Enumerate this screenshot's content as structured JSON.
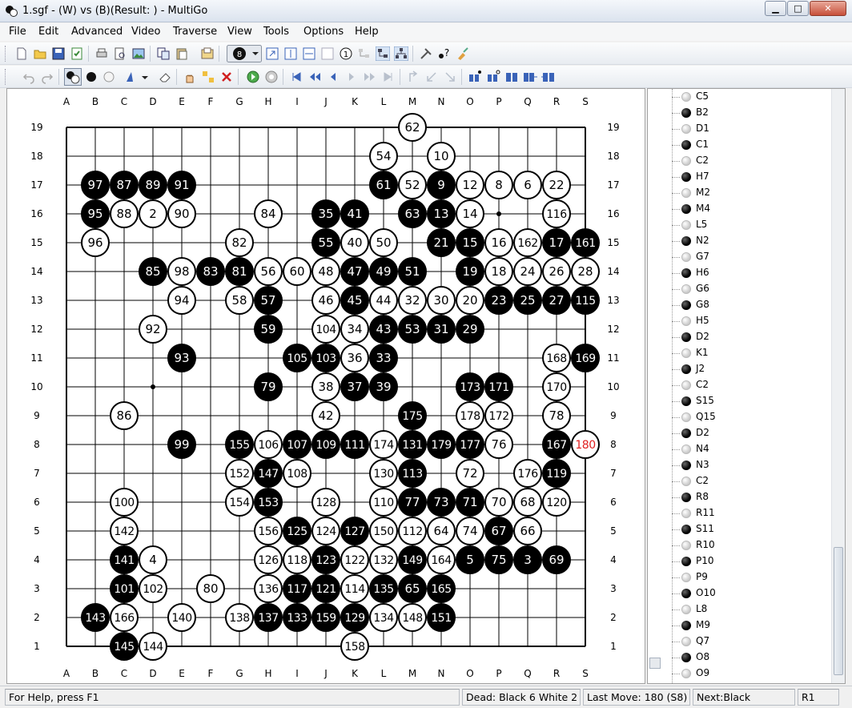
{
  "window": {
    "title": "1.sgf -  (W) vs  (B)(Result: ) - MultiGo"
  },
  "menu": [
    "File",
    "Edit",
    "Advanced",
    "Video",
    "Traverse",
    "View",
    "Tools",
    "Options",
    "Help"
  ],
  "board": {
    "columns": [
      "A",
      "B",
      "C",
      "D",
      "E",
      "F",
      "G",
      "H",
      "I",
      "J",
      "K",
      "L",
      "M",
      "N",
      "O",
      "P",
      "Q",
      "R",
      "S"
    ],
    "rows": [
      "19",
      "18",
      "17",
      "16",
      "15",
      "14",
      "13",
      "12",
      "11",
      "10",
      "9",
      "8",
      "7",
      "6",
      "5",
      "4",
      "3",
      "2",
      "1"
    ],
    "stones": [
      {
        "c": "M",
        "r": 19,
        "color": "white",
        "num": "62"
      },
      {
        "c": "L",
        "r": 18,
        "color": "white",
        "num": "54"
      },
      {
        "c": "N",
        "r": 18,
        "color": "white",
        "num": "10"
      },
      {
        "c": "B",
        "r": 17,
        "color": "black",
        "num": "97"
      },
      {
        "c": "C",
        "r": 17,
        "color": "black",
        "num": "87"
      },
      {
        "c": "D",
        "r": 17,
        "color": "black",
        "num": "89"
      },
      {
        "c": "E",
        "r": 17,
        "color": "black",
        "num": "91"
      },
      {
        "c": "L",
        "r": 17,
        "color": "black",
        "num": "61"
      },
      {
        "c": "M",
        "r": 17,
        "color": "white",
        "num": "52"
      },
      {
        "c": "N",
        "r": 17,
        "color": "black",
        "num": "9"
      },
      {
        "c": "O",
        "r": 17,
        "color": "white",
        "num": "12"
      },
      {
        "c": "P",
        "r": 17,
        "color": "white",
        "num": "8"
      },
      {
        "c": "Q",
        "r": 17,
        "color": "white",
        "num": "6"
      },
      {
        "c": "R",
        "r": 17,
        "color": "white",
        "num": "22"
      },
      {
        "c": "B",
        "r": 16,
        "color": "black",
        "num": "95"
      },
      {
        "c": "C",
        "r": 16,
        "color": "white",
        "num": "88"
      },
      {
        "c": "D",
        "r": 16,
        "color": "white",
        "num": "2"
      },
      {
        "c": "E",
        "r": 16,
        "color": "white",
        "num": "90"
      },
      {
        "c": "H",
        "r": 16,
        "color": "white",
        "num": "84"
      },
      {
        "c": "J",
        "r": 16,
        "color": "black",
        "num": "35"
      },
      {
        "c": "K",
        "r": 16,
        "color": "black",
        "num": "41"
      },
      {
        "c": "M",
        "r": 16,
        "color": "black",
        "num": "63"
      },
      {
        "c": "N",
        "r": 16,
        "color": "black",
        "num": "13"
      },
      {
        "c": "O",
        "r": 16,
        "color": "white",
        "num": "14"
      },
      {
        "c": "R",
        "r": 16,
        "color": "white",
        "num": "116"
      },
      {
        "c": "B",
        "r": 15,
        "color": "white",
        "num": "96"
      },
      {
        "c": "G",
        "r": 15,
        "color": "white",
        "num": "82"
      },
      {
        "c": "J",
        "r": 15,
        "color": "black",
        "num": "55"
      },
      {
        "c": "K",
        "r": 15,
        "color": "white",
        "num": "40"
      },
      {
        "c": "L",
        "r": 15,
        "color": "white",
        "num": "50"
      },
      {
        "c": "N",
        "r": 15,
        "color": "black",
        "num": "21"
      },
      {
        "c": "O",
        "r": 15,
        "color": "black",
        "num": "15"
      },
      {
        "c": "P",
        "r": 15,
        "color": "white",
        "num": "16"
      },
      {
        "c": "Q",
        "r": 15,
        "color": "white",
        "num": "162"
      },
      {
        "c": "R",
        "r": 15,
        "color": "black",
        "num": "17"
      },
      {
        "c": "S",
        "r": 15,
        "color": "black",
        "num": "161"
      },
      {
        "c": "D",
        "r": 14,
        "color": "black",
        "num": "85"
      },
      {
        "c": "E",
        "r": 14,
        "color": "white",
        "num": "98"
      },
      {
        "c": "F",
        "r": 14,
        "color": "black",
        "num": "83"
      },
      {
        "c": "G",
        "r": 14,
        "color": "black",
        "num": "81"
      },
      {
        "c": "H",
        "r": 14,
        "color": "white",
        "num": "56"
      },
      {
        "c": "I",
        "r": 14,
        "color": "white",
        "num": "60"
      },
      {
        "c": "J",
        "r": 14,
        "color": "white",
        "num": "48"
      },
      {
        "c": "K",
        "r": 14,
        "color": "black",
        "num": "47"
      },
      {
        "c": "L",
        "r": 14,
        "color": "black",
        "num": "49"
      },
      {
        "c": "M",
        "r": 14,
        "color": "black",
        "num": "51"
      },
      {
        "c": "O",
        "r": 14,
        "color": "black",
        "num": "19"
      },
      {
        "c": "P",
        "r": 14,
        "color": "white",
        "num": "18"
      },
      {
        "c": "Q",
        "r": 14,
        "color": "white",
        "num": "24"
      },
      {
        "c": "R",
        "r": 14,
        "color": "white",
        "num": "26"
      },
      {
        "c": "S",
        "r": 14,
        "color": "white",
        "num": "28"
      },
      {
        "c": "E",
        "r": 13,
        "color": "white",
        "num": "94"
      },
      {
        "c": "G",
        "r": 13,
        "color": "white",
        "num": "58"
      },
      {
        "c": "H",
        "r": 13,
        "color": "black",
        "num": "57"
      },
      {
        "c": "J",
        "r": 13,
        "color": "white",
        "num": "46"
      },
      {
        "c": "K",
        "r": 13,
        "color": "black",
        "num": "45"
      },
      {
        "c": "L",
        "r": 13,
        "color": "white",
        "num": "44"
      },
      {
        "c": "M",
        "r": 13,
        "color": "white",
        "num": "32"
      },
      {
        "c": "N",
        "r": 13,
        "color": "white",
        "num": "30"
      },
      {
        "c": "O",
        "r": 13,
        "color": "white",
        "num": "20"
      },
      {
        "c": "P",
        "r": 13,
        "color": "black",
        "num": "23"
      },
      {
        "c": "Q",
        "r": 13,
        "color": "black",
        "num": "25"
      },
      {
        "c": "R",
        "r": 13,
        "color": "black",
        "num": "27"
      },
      {
        "c": "S",
        "r": 13,
        "color": "black",
        "num": "115"
      },
      {
        "c": "D",
        "r": 12,
        "color": "white",
        "num": "92"
      },
      {
        "c": "H",
        "r": 12,
        "color": "black",
        "num": "59"
      },
      {
        "c": "J",
        "r": 12,
        "color": "white",
        "num": "104"
      },
      {
        "c": "K",
        "r": 12,
        "color": "white",
        "num": "34"
      },
      {
        "c": "L",
        "r": 12,
        "color": "black",
        "num": "43"
      },
      {
        "c": "M",
        "r": 12,
        "color": "black",
        "num": "53"
      },
      {
        "c": "N",
        "r": 12,
        "color": "black",
        "num": "31"
      },
      {
        "c": "O",
        "r": 12,
        "color": "black",
        "num": "29"
      },
      {
        "c": "E",
        "r": 11,
        "color": "black",
        "num": "93"
      },
      {
        "c": "I",
        "r": 11,
        "color": "black",
        "num": "105"
      },
      {
        "c": "J",
        "r": 11,
        "color": "black",
        "num": "103"
      },
      {
        "c": "K",
        "r": 11,
        "color": "white",
        "num": "36"
      },
      {
        "c": "L",
        "r": 11,
        "color": "black",
        "num": "33"
      },
      {
        "c": "R",
        "r": 11,
        "color": "white",
        "num": "168"
      },
      {
        "c": "S",
        "r": 11,
        "color": "black",
        "num": "169"
      },
      {
        "c": "H",
        "r": 10,
        "color": "black",
        "num": "79"
      },
      {
        "c": "J",
        "r": 10,
        "color": "white",
        "num": "38"
      },
      {
        "c": "K",
        "r": 10,
        "color": "black",
        "num": "37"
      },
      {
        "c": "L",
        "r": 10,
        "color": "black",
        "num": "39"
      },
      {
        "c": "O",
        "r": 10,
        "color": "black",
        "num": "173"
      },
      {
        "c": "P",
        "r": 10,
        "color": "black",
        "num": "171"
      },
      {
        "c": "R",
        "r": 10,
        "color": "white",
        "num": "170"
      },
      {
        "c": "C",
        "r": 9,
        "color": "white",
        "num": "86"
      },
      {
        "c": "J",
        "r": 9,
        "color": "white",
        "num": "42"
      },
      {
        "c": "M",
        "r": 9,
        "color": "black",
        "num": "175"
      },
      {
        "c": "O",
        "r": 9,
        "color": "white",
        "num": "178"
      },
      {
        "c": "P",
        "r": 9,
        "color": "white",
        "num": "172"
      },
      {
        "c": "R",
        "r": 9,
        "color": "white",
        "num": "78"
      },
      {
        "c": "E",
        "r": 8,
        "color": "black",
        "num": "99"
      },
      {
        "c": "G",
        "r": 8,
        "color": "black",
        "num": "155"
      },
      {
        "c": "H",
        "r": 8,
        "color": "white",
        "num": "106"
      },
      {
        "c": "I",
        "r": 8,
        "color": "black",
        "num": "107"
      },
      {
        "c": "J",
        "r": 8,
        "color": "black",
        "num": "109"
      },
      {
        "c": "K",
        "r": 8,
        "color": "black",
        "num": "111"
      },
      {
        "c": "L",
        "r": 8,
        "color": "white",
        "num": "174"
      },
      {
        "c": "M",
        "r": 8,
        "color": "black",
        "num": "131"
      },
      {
        "c": "N",
        "r": 8,
        "color": "black",
        "num": "179"
      },
      {
        "c": "O",
        "r": 8,
        "color": "black",
        "num": "177"
      },
      {
        "c": "P",
        "r": 8,
        "color": "white",
        "num": "76"
      },
      {
        "c": "R",
        "r": 8,
        "color": "black",
        "num": "167"
      },
      {
        "c": "S",
        "r": 8,
        "color": "white",
        "num": "180",
        "last": true
      },
      {
        "c": "G",
        "r": 7,
        "color": "white",
        "num": "152"
      },
      {
        "c": "H",
        "r": 7,
        "color": "black",
        "num": "147"
      },
      {
        "c": "I",
        "r": 7,
        "color": "white",
        "num": "108"
      },
      {
        "c": "L",
        "r": 7,
        "color": "white",
        "num": "130"
      },
      {
        "c": "M",
        "r": 7,
        "color": "black",
        "num": "113"
      },
      {
        "c": "O",
        "r": 7,
        "color": "white",
        "num": "72"
      },
      {
        "c": "Q",
        "r": 7,
        "color": "white",
        "num": "176"
      },
      {
        "c": "R",
        "r": 7,
        "color": "black",
        "num": "119"
      },
      {
        "c": "C",
        "r": 6,
        "color": "white",
        "num": "100"
      },
      {
        "c": "G",
        "r": 6,
        "color": "white",
        "num": "154"
      },
      {
        "c": "H",
        "r": 6,
        "color": "black",
        "num": "153"
      },
      {
        "c": "J",
        "r": 6,
        "color": "white",
        "num": "128"
      },
      {
        "c": "L",
        "r": 6,
        "color": "white",
        "num": "110"
      },
      {
        "c": "M",
        "r": 6,
        "color": "black",
        "num": "77"
      },
      {
        "c": "N",
        "r": 6,
        "color": "black",
        "num": "73"
      },
      {
        "c": "O",
        "r": 6,
        "color": "black",
        "num": "71"
      },
      {
        "c": "P",
        "r": 6,
        "color": "white",
        "num": "70"
      },
      {
        "c": "Q",
        "r": 6,
        "color": "white",
        "num": "68"
      },
      {
        "c": "R",
        "r": 6,
        "color": "white",
        "num": "120"
      },
      {
        "c": "C",
        "r": 5,
        "color": "white",
        "num": "142"
      },
      {
        "c": "H",
        "r": 5,
        "color": "white",
        "num": "156"
      },
      {
        "c": "I",
        "r": 5,
        "color": "black",
        "num": "125"
      },
      {
        "c": "J",
        "r": 5,
        "color": "white",
        "num": "124"
      },
      {
        "c": "K",
        "r": 5,
        "color": "black",
        "num": "127"
      },
      {
        "c": "L",
        "r": 5,
        "color": "white",
        "num": "150"
      },
      {
        "c": "M",
        "r": 5,
        "color": "white",
        "num": "112"
      },
      {
        "c": "N",
        "r": 5,
        "color": "white",
        "num": "64"
      },
      {
        "c": "O",
        "r": 5,
        "color": "white",
        "num": "74"
      },
      {
        "c": "P",
        "r": 5,
        "color": "black",
        "num": "67"
      },
      {
        "c": "Q",
        "r": 5,
        "color": "white",
        "num": "66"
      },
      {
        "c": "C",
        "r": 4,
        "color": "black",
        "num": "141"
      },
      {
        "c": "D",
        "r": 4,
        "color": "white",
        "num": "4"
      },
      {
        "c": "H",
        "r": 4,
        "color": "white",
        "num": "126"
      },
      {
        "c": "I",
        "r": 4,
        "color": "white",
        "num": "118"
      },
      {
        "c": "J",
        "r": 4,
        "color": "black",
        "num": "123"
      },
      {
        "c": "K",
        "r": 4,
        "color": "white",
        "num": "122"
      },
      {
        "c": "L",
        "r": 4,
        "color": "white",
        "num": "132"
      },
      {
        "c": "M",
        "r": 4,
        "color": "black",
        "num": "149"
      },
      {
        "c": "N",
        "r": 4,
        "color": "white",
        "num": "164"
      },
      {
        "c": "O",
        "r": 4,
        "color": "black",
        "num": "5"
      },
      {
        "c": "P",
        "r": 4,
        "color": "black",
        "num": "75"
      },
      {
        "c": "Q",
        "r": 4,
        "color": "black",
        "num": "3"
      },
      {
        "c": "R",
        "r": 4,
        "color": "black",
        "num": "69"
      },
      {
        "c": "C",
        "r": 3,
        "color": "black",
        "num": "101"
      },
      {
        "c": "D",
        "r": 3,
        "color": "white",
        "num": "102"
      },
      {
        "c": "F",
        "r": 3,
        "color": "white",
        "num": "80"
      },
      {
        "c": "H",
        "r": 3,
        "color": "white",
        "num": "136"
      },
      {
        "c": "I",
        "r": 3,
        "color": "black",
        "num": "117"
      },
      {
        "c": "J",
        "r": 3,
        "color": "black",
        "num": "121"
      },
      {
        "c": "K",
        "r": 3,
        "color": "white",
        "num": "114"
      },
      {
        "c": "L",
        "r": 3,
        "color": "black",
        "num": "135"
      },
      {
        "c": "M",
        "r": 3,
        "color": "black",
        "num": "65"
      },
      {
        "c": "N",
        "r": 3,
        "color": "black",
        "num": "165"
      },
      {
        "c": "B",
        "r": 2,
        "color": "black",
        "num": "143"
      },
      {
        "c": "C",
        "r": 2,
        "color": "white",
        "num": "166"
      },
      {
        "c": "E",
        "r": 2,
        "color": "white",
        "num": "140"
      },
      {
        "c": "G",
        "r": 2,
        "color": "white",
        "num": "138"
      },
      {
        "c": "H",
        "r": 2,
        "color": "black",
        "num": "137"
      },
      {
        "c": "I",
        "r": 2,
        "color": "black",
        "num": "133"
      },
      {
        "c": "J",
        "r": 2,
        "color": "black",
        "num": "159"
      },
      {
        "c": "K",
        "r": 2,
        "color": "black",
        "num": "129"
      },
      {
        "c": "L",
        "r": 2,
        "color": "white",
        "num": "134"
      },
      {
        "c": "M",
        "r": 2,
        "color": "white",
        "num": "148"
      },
      {
        "c": "N",
        "r": 2,
        "color": "black",
        "num": "151"
      },
      {
        "c": "C",
        "r": 1,
        "color": "black",
        "num": "145"
      },
      {
        "c": "D",
        "r": 1,
        "color": "white",
        "num": "144"
      },
      {
        "c": "K",
        "r": 1,
        "color": "white",
        "num": "158"
      }
    ],
    "colors": {
      "last_move_number": "#e02020"
    }
  },
  "move_list": [
    {
      "color": "white",
      "move": "C5"
    },
    {
      "color": "black",
      "move": "B2"
    },
    {
      "color": "white",
      "move": "D1"
    },
    {
      "color": "black",
      "move": "C1"
    },
    {
      "color": "white",
      "move": "C2"
    },
    {
      "color": "black",
      "move": "H7"
    },
    {
      "color": "white",
      "move": "M2"
    },
    {
      "color": "black",
      "move": "M4"
    },
    {
      "color": "white",
      "move": "L5"
    },
    {
      "color": "black",
      "move": "N2"
    },
    {
      "color": "white",
      "move": "G7"
    },
    {
      "color": "black",
      "move": "H6"
    },
    {
      "color": "white",
      "move": "G6"
    },
    {
      "color": "black",
      "move": "G8"
    },
    {
      "color": "white",
      "move": "H5"
    },
    {
      "color": "black",
      "move": "D2"
    },
    {
      "color": "white",
      "move": "K1"
    },
    {
      "color": "black",
      "move": "J2"
    },
    {
      "color": "white",
      "move": "C2"
    },
    {
      "color": "black",
      "move": "S15"
    },
    {
      "color": "white",
      "move": "Q15"
    },
    {
      "color": "black",
      "move": "D2"
    },
    {
      "color": "white",
      "move": "N4"
    },
    {
      "color": "black",
      "move": "N3"
    },
    {
      "color": "white",
      "move": "C2"
    },
    {
      "color": "black",
      "move": "R8"
    },
    {
      "color": "white",
      "move": "R11"
    },
    {
      "color": "black",
      "move": "S11"
    },
    {
      "color": "white",
      "move": "R10"
    },
    {
      "color": "black",
      "move": "P10"
    },
    {
      "color": "white",
      "move": "P9"
    },
    {
      "color": "black",
      "move": "O10"
    },
    {
      "color": "white",
      "move": "L8"
    },
    {
      "color": "black",
      "move": "M9"
    },
    {
      "color": "white",
      "move": "Q7"
    },
    {
      "color": "black",
      "move": "O8"
    },
    {
      "color": "white",
      "move": "O9"
    }
  ],
  "status": {
    "help": "For Help, press F1",
    "dead": "Dead: Black 6 White 2",
    "last_move": "Last Move: 180 (S8)",
    "next": "Next:Black",
    "rank": "R1"
  }
}
